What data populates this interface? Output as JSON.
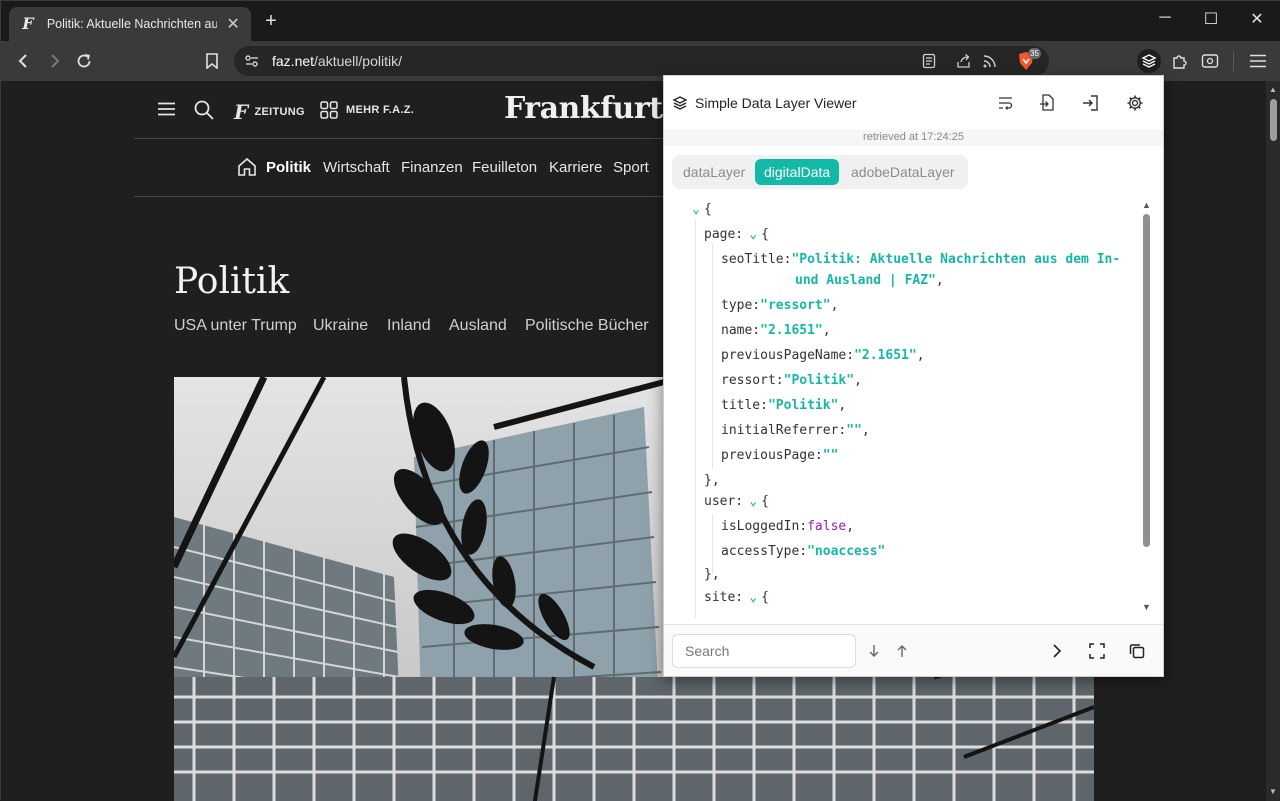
{
  "browser": {
    "tab_title": "Politik: Aktuelle Nachrichten aus",
    "tab_favicon": "F",
    "url_host": "faz.net",
    "url_path": "/aktuell/politik/",
    "shields_count": "35"
  },
  "site": {
    "header": {
      "zeitung": "ZEITUNG",
      "mehr": "MEHR F.A.Z.",
      "logo": "Frankfurter Allgemeine"
    },
    "nav": [
      "Politik",
      "Wirtschaft",
      "Finanzen",
      "Feuilleton",
      "Karriere",
      "Sport"
    ],
    "section_title": "Politik",
    "subnav": [
      "USA unter Trump",
      "Ukraine",
      "Inland",
      "Ausland",
      "Politische Bücher"
    ]
  },
  "extension": {
    "title": "Simple Data Layer Viewer",
    "retrieved": "retrieved at 17:24:25",
    "tabs": [
      "dataLayer",
      "digitalData",
      "adobeDataLayer"
    ],
    "active_tab": "digitalData",
    "json": {
      "open_brace": "{",
      "page_key": "page:",
      "seoTitle_key": "seoTitle:",
      "seoTitle_l1": "\"Politik: Aktuelle Nachrichten aus dem In-",
      "seoTitle_l2": "und Ausland | FAZ\"",
      "type_key": "type:",
      "type_val": "\"ressort\"",
      "name_key": "name:",
      "name_val": "\"2.1651\"",
      "previousPageName_key": "previousPageName:",
      "previousPageName_val": "\"2.1651\"",
      "ressort_key": "ressort:",
      "ressort_val": "\"Politik\"",
      "title_key": "title:",
      "title_val": "\"Politik\"",
      "initialReferrer_key": "initialReferrer:",
      "initialReferrer_val": "\"\"",
      "previousPage_key": "previousPage:",
      "previousPage_val": "\"\"",
      "close_comma": "},",
      "user_key": "user:",
      "isLoggedIn_key": "isLoggedIn:",
      "isLoggedIn_val": "false",
      "accessType_key": "accessType:",
      "accessType_val": "\"noaccess\"",
      "site_key": "site:"
    },
    "search_placeholder": "Search"
  },
  "colors": {
    "accent": "#14b8a6",
    "boolean": "#a21caf"
  }
}
